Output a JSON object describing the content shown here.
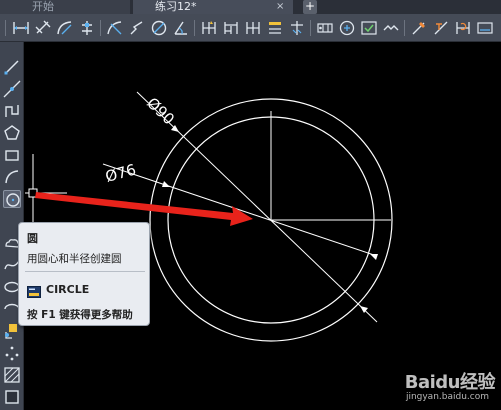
{
  "tabs": {
    "start": "开始",
    "active": "练习12*",
    "close_glyph": "×",
    "add_glyph": "+"
  },
  "toolbar": {
    "icons": [
      "linear-dimension-icon",
      "aligned-dimension-icon",
      "arc-length-icon",
      "ordinate-dimension-icon",
      "radius-dimension-icon",
      "jogged-icon",
      "diameter-dimension-icon",
      "angular-dimension-icon",
      "quick-dimension-icon",
      "baseline-icon",
      "continue-icon",
      "dimension-space-icon",
      "dimension-break-icon",
      "tolerance-icon",
      "center-mark-icon",
      "inspection-icon",
      "jogged-linear-icon",
      "dimension-edit-icon",
      "text-edit-icon",
      "dimension-update-icon"
    ]
  },
  "left_toolbar": {
    "icons": [
      "line-icon",
      "construction-line-icon",
      "polyline-icon",
      "polygon-icon",
      "rectangle-icon",
      "arc-icon",
      "circle-icon",
      "revision-cloud-icon",
      "spline-icon",
      "ellipse-icon",
      "ellipse-arc-icon",
      "insert-block-icon",
      "make-block-icon",
      "point-icon",
      "hatch-icon",
      "region-icon"
    ]
  },
  "drawing": {
    "dim_outer": "Ø90",
    "dim_inner": "Ø76",
    "line_color": "#ffffff",
    "arrow_color": "#e8231b"
  },
  "tooltip": {
    "title": "圆",
    "description": "用圆心和半径创建圆",
    "command": "CIRCLE",
    "help": "按 F1 键获得更多帮助"
  },
  "watermark": {
    "brand": "Baidu经验",
    "url": "jingyan.baidu.com"
  }
}
